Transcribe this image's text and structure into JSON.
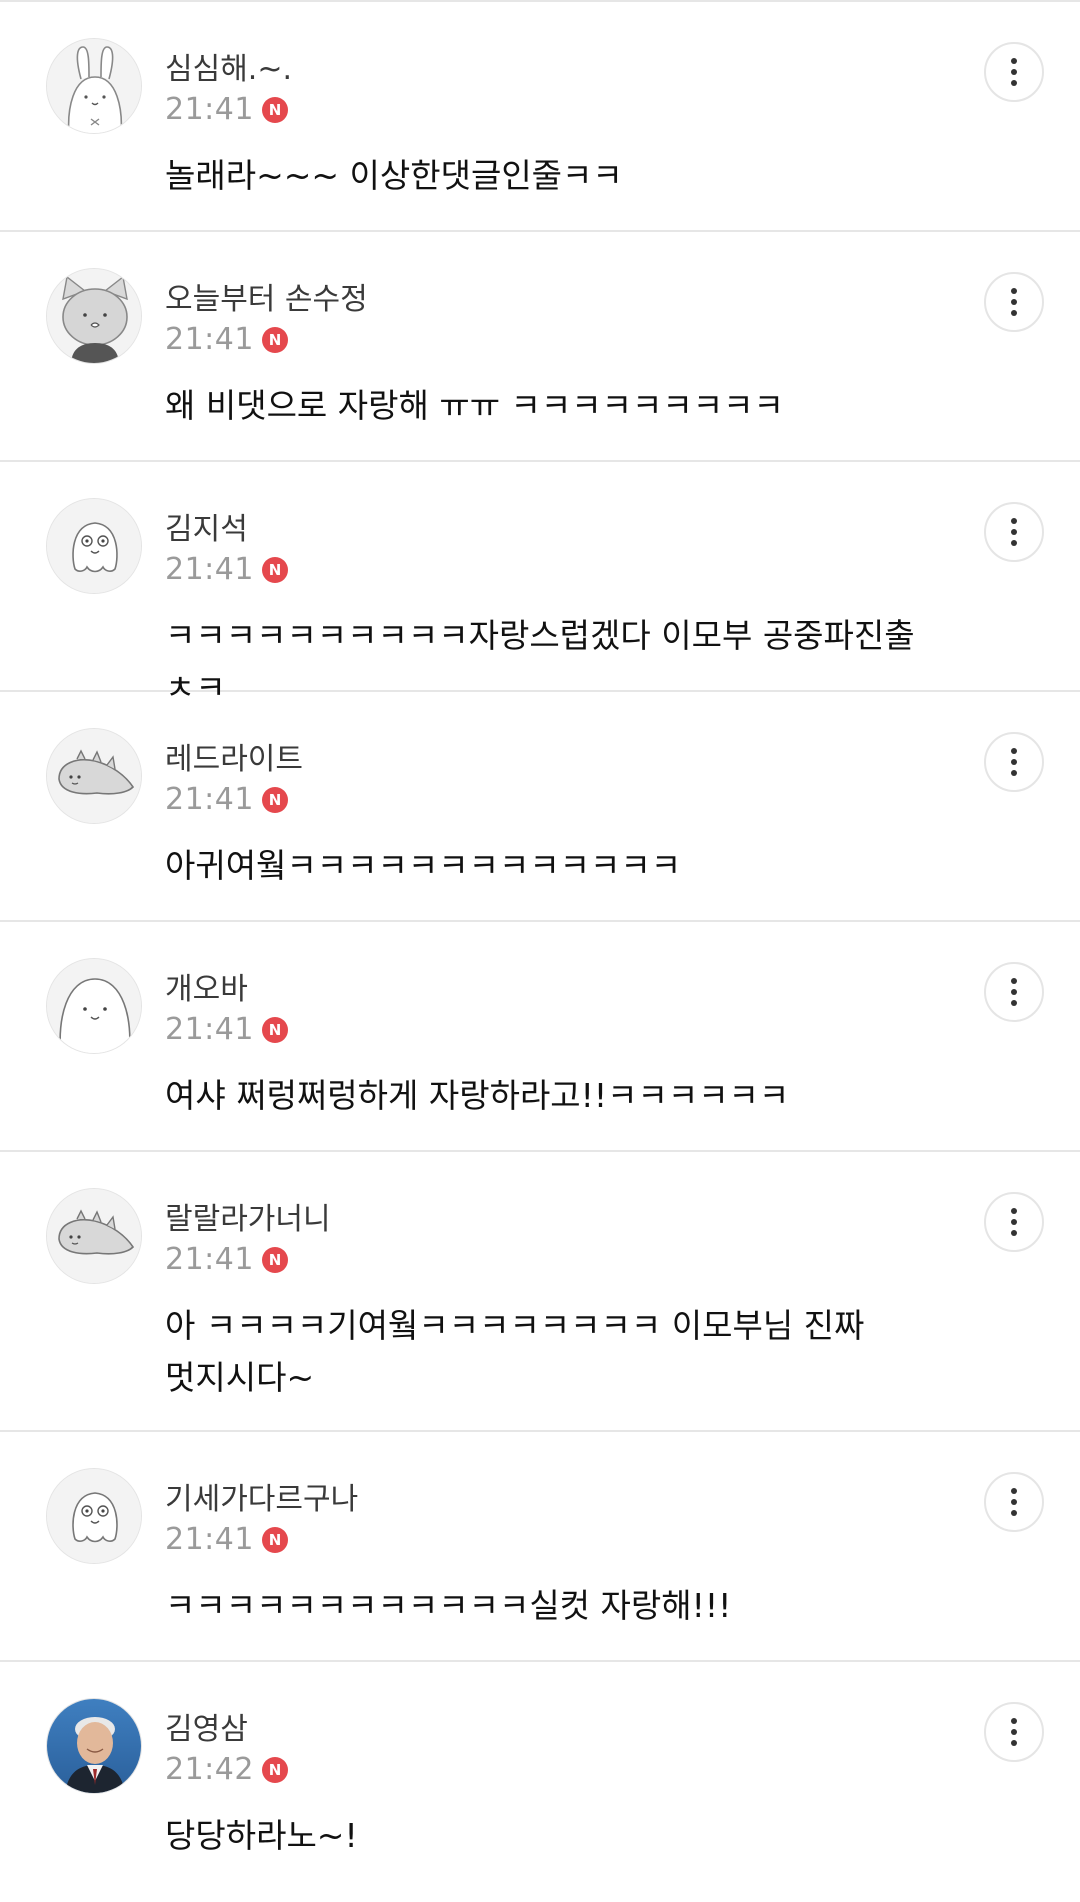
{
  "comments": [
    {
      "nickname": "심심해.~.",
      "time": "21:41",
      "badge": "N",
      "text": "놀래라~~~ 이상한댓글인줄ㅋㅋ",
      "avatar_icon": "bunny-avatar-icon"
    },
    {
      "nickname": "오늘부터 손수정",
      "time": "21:41",
      "badge": "N",
      "text": "왜 비댓으로 자랑해 ㅠㅠ ㅋㅋㅋㅋㅋㅋㅋㅋㅋ",
      "avatar_icon": "cat-avatar-icon"
    },
    {
      "nickname": "김지석",
      "time": "21:41",
      "badge": "N",
      "text": "ㅋㅋㅋㅋㅋㅋㅋㅋㅋㅋ자랑스럽겠다 이모부 공중파진출 ㅊㅋ",
      "avatar_icon": "ghost-avatar-icon"
    },
    {
      "nickname": "레드라이트",
      "time": "21:41",
      "badge": "N",
      "text": "아귀여웤ㅋㅋㅋㅋㅋㅋㅋㅋㅋㅋㅋㅋㅋ",
      "avatar_icon": "dino-avatar-icon"
    },
    {
      "nickname": "개오바",
      "time": "21:41",
      "badge": "N",
      "text": "여샤 쩌렁쩌렁하게 자랑하라고!!ㅋㅋㅋㅋㅋㅋ",
      "avatar_icon": "blob-avatar-icon"
    },
    {
      "nickname": "랄랄라가너니",
      "time": "21:41",
      "badge": "N",
      "text": "아 ㅋㅋㅋㅋ기여웤ㅋㅋㅋㅋㅋㅋㅋㅋ 이모부님 진짜\n멋지시다~",
      "avatar_icon": "dino-avatar-icon"
    },
    {
      "nickname": "기세가다르구나",
      "time": "21:41",
      "badge": "N",
      "text": "ㅋㅋㅋㅋㅋㅋㅋㅋㅋㅋㅋㅋ실컷 자랑해!!!",
      "avatar_icon": "ghost-avatar-icon"
    },
    {
      "nickname": "김영삼",
      "time": "21:42",
      "badge": "N",
      "text": "당당하라노~!",
      "avatar_icon": "person-photo-avatar-icon"
    }
  ],
  "colors": {
    "badge": "#e5484d",
    "divider": "#e6e6e6",
    "time": "#9a9a9a"
  }
}
